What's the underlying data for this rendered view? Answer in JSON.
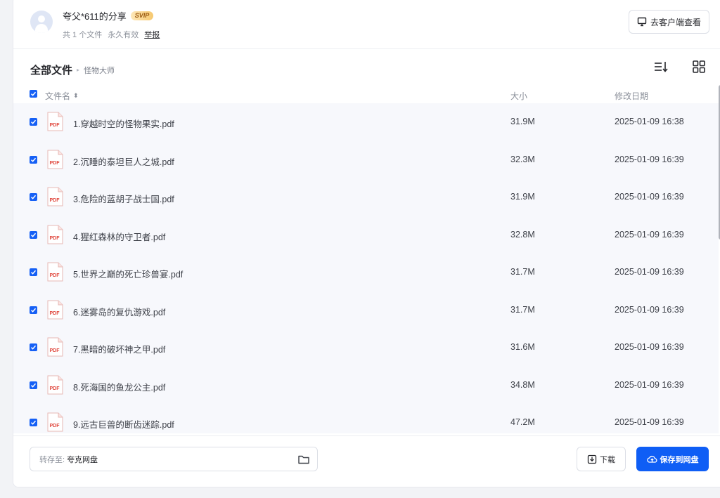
{
  "header": {
    "title": "夸父*611的分享",
    "badge": "SVIP",
    "file_count": "共 1 个文件",
    "validity": "永久有效",
    "report": "举报",
    "client_button": "去客户端查看"
  },
  "breadcrumb": {
    "root": "全部文件",
    "separator": "▸",
    "current": "怪物大师"
  },
  "columns": {
    "name": "文件名",
    "sort_arrow": "⬍",
    "size": "大小",
    "date": "修改日期"
  },
  "files": [
    {
      "name": "1.穿越时空的怪物果实.pdf",
      "size": "31.9M",
      "date": "2025-01-09 16:38"
    },
    {
      "name": "2.沉睡的泰坦巨人之城.pdf",
      "size": "32.3M",
      "date": "2025-01-09 16:39"
    },
    {
      "name": "3.危险的蓝胡子战士国.pdf",
      "size": "31.9M",
      "date": "2025-01-09 16:39"
    },
    {
      "name": "4.猩红森林的守卫者.pdf",
      "size": "32.8M",
      "date": "2025-01-09 16:39"
    },
    {
      "name": "5.世界之巅的死亡珍兽宴.pdf",
      "size": "31.7M",
      "date": "2025-01-09 16:39"
    },
    {
      "name": "6.迷雾岛的复仇游戏.pdf",
      "size": "31.7M",
      "date": "2025-01-09 16:39"
    },
    {
      "name": "7.黑暗的破坏神之甲.pdf",
      "size": "31.6M",
      "date": "2025-01-09 16:39"
    },
    {
      "name": "8.死海国的鱼龙公主.pdf",
      "size": "34.8M",
      "date": "2025-01-09 16:39"
    },
    {
      "name": "9.远古巨兽的断齿迷踪.pdf",
      "size": "47.2M",
      "date": "2025-01-09 16:39"
    }
  ],
  "pdf_label": "PDF",
  "footer": {
    "dest_label": "转存至:",
    "dest_value": "夸克网盘",
    "download": "下载",
    "save": "保存到网盘"
  },
  "colors": {
    "accent": "#0f5ef5",
    "checkbox": "#1660f5",
    "pdf_red": "#e0473d"
  }
}
